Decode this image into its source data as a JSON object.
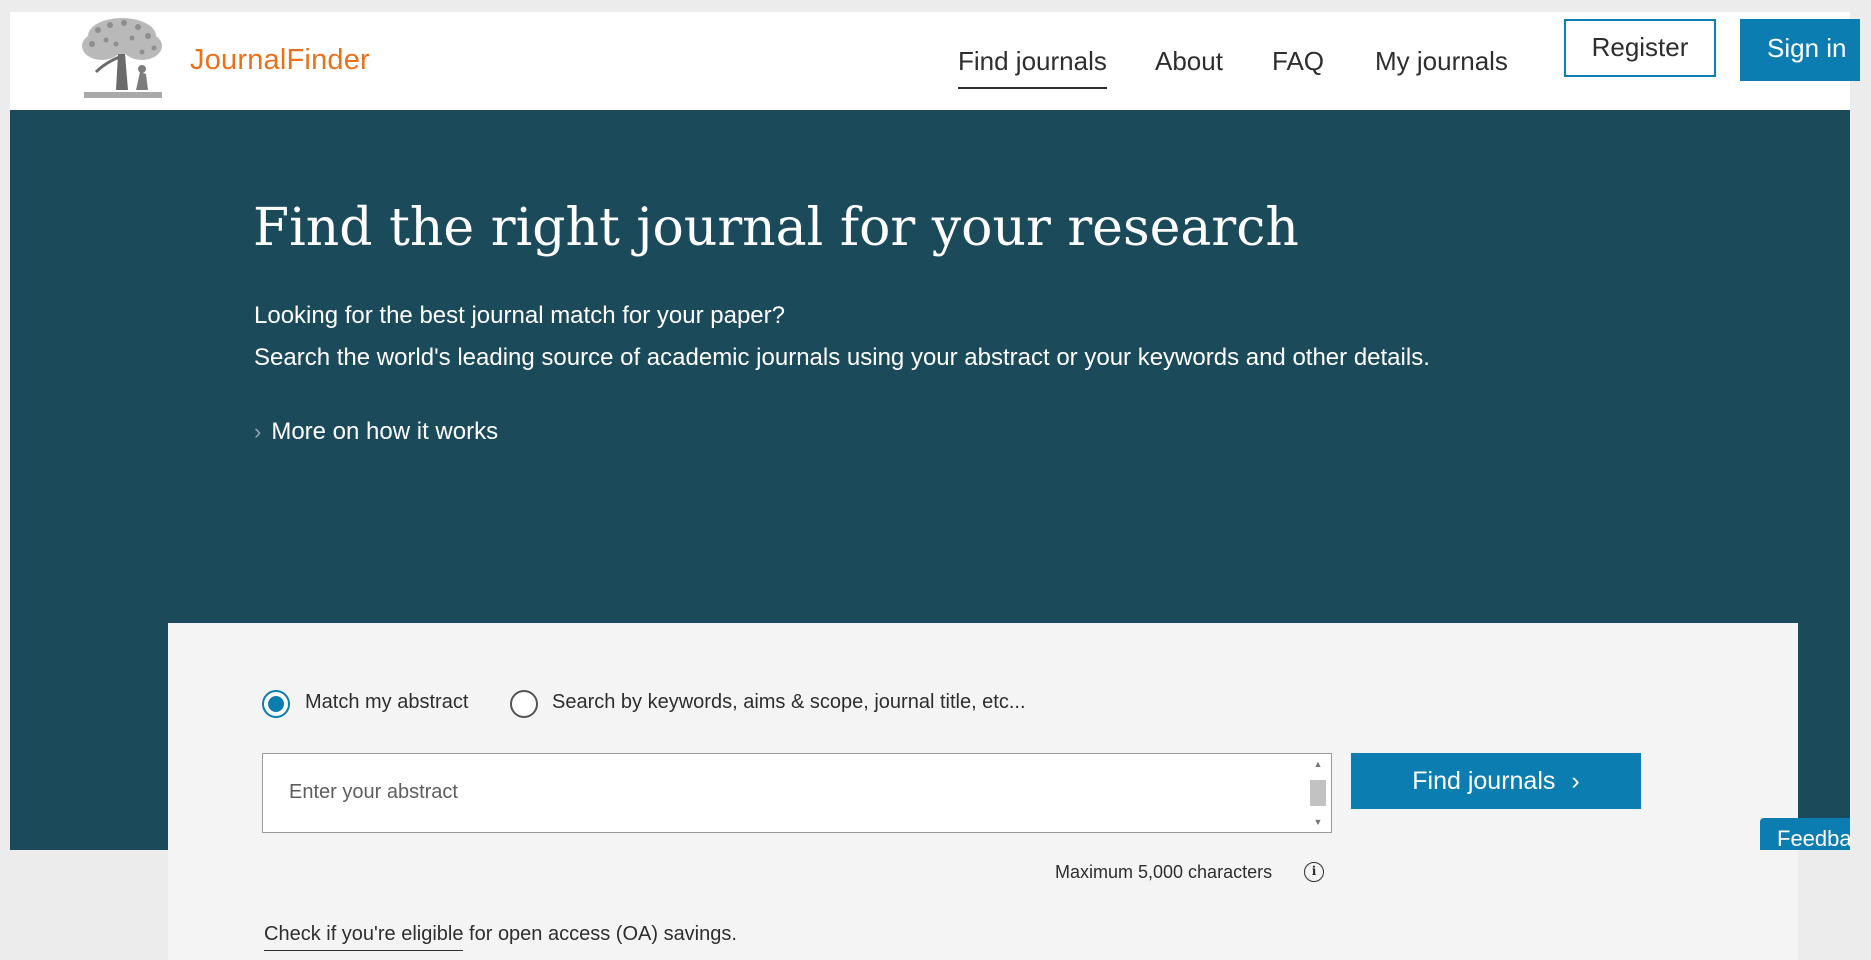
{
  "header": {
    "logo_icon": "elsevier-tree-icon",
    "brand": "JournalFinder",
    "nav": {
      "find_journals": "Find journals",
      "about": "About",
      "faq": "FAQ",
      "my_journals": "My journals"
    },
    "register_label": "Register",
    "signin_label": "Sign in"
  },
  "hero": {
    "title": "Find the right journal for your research",
    "line1": "Looking for the best journal match for your paper?",
    "line2": "Search the world's leading source of academic journals using your abstract or your keywords and other details.",
    "more_link": "More on how it works"
  },
  "search": {
    "mode_abstract_label": "Match my abstract",
    "mode_keywords_label": "Search by keywords, aims & scope, journal title, etc...",
    "selected_mode": "abstract",
    "abstract_placeholder": "Enter your abstract",
    "abstract_value": "",
    "find_button_label": "Find journals",
    "max_chars_text": "Maximum 5,000 characters",
    "oa_link_text": "Check if you're eligible",
    "oa_rest_text": " for open access (OA) savings."
  },
  "feedback_label": "Feedback",
  "colors": {
    "brand_orange": "#e9711c",
    "primary_blue": "#0c7db1",
    "hero_background": "#1b4a5a"
  }
}
